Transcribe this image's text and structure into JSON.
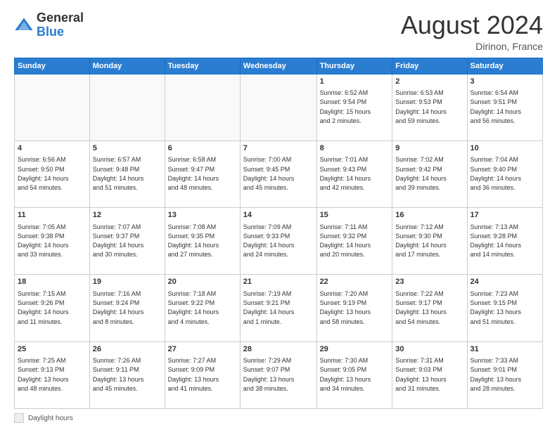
{
  "logo": {
    "line1": "General",
    "line2": "Blue"
  },
  "title": "August 2024",
  "location": "Dirinon, France",
  "days_of_week": [
    "Sunday",
    "Monday",
    "Tuesday",
    "Wednesday",
    "Thursday",
    "Friday",
    "Saturday"
  ],
  "footer": {
    "label": "Daylight hours"
  },
  "weeks": [
    [
      {
        "day": "",
        "info": ""
      },
      {
        "day": "",
        "info": ""
      },
      {
        "day": "",
        "info": ""
      },
      {
        "day": "",
        "info": ""
      },
      {
        "day": "1",
        "info": "Sunrise: 6:52 AM\nSunset: 9:54 PM\nDaylight: 15 hours\nand 2 minutes."
      },
      {
        "day": "2",
        "info": "Sunrise: 6:53 AM\nSunset: 9:53 PM\nDaylight: 14 hours\nand 59 minutes."
      },
      {
        "day": "3",
        "info": "Sunrise: 6:54 AM\nSunset: 9:51 PM\nDaylight: 14 hours\nand 56 minutes."
      }
    ],
    [
      {
        "day": "4",
        "info": "Sunrise: 6:56 AM\nSunset: 9:50 PM\nDaylight: 14 hours\nand 54 minutes."
      },
      {
        "day": "5",
        "info": "Sunrise: 6:57 AM\nSunset: 9:48 PM\nDaylight: 14 hours\nand 51 minutes."
      },
      {
        "day": "6",
        "info": "Sunrise: 6:58 AM\nSunset: 9:47 PM\nDaylight: 14 hours\nand 48 minutes."
      },
      {
        "day": "7",
        "info": "Sunrise: 7:00 AM\nSunset: 9:45 PM\nDaylight: 14 hours\nand 45 minutes."
      },
      {
        "day": "8",
        "info": "Sunrise: 7:01 AM\nSunset: 9:43 PM\nDaylight: 14 hours\nand 42 minutes."
      },
      {
        "day": "9",
        "info": "Sunrise: 7:02 AM\nSunset: 9:42 PM\nDaylight: 14 hours\nand 39 minutes."
      },
      {
        "day": "10",
        "info": "Sunrise: 7:04 AM\nSunset: 9:40 PM\nDaylight: 14 hours\nand 36 minutes."
      }
    ],
    [
      {
        "day": "11",
        "info": "Sunrise: 7:05 AM\nSunset: 9:38 PM\nDaylight: 14 hours\nand 33 minutes."
      },
      {
        "day": "12",
        "info": "Sunrise: 7:07 AM\nSunset: 9:37 PM\nDaylight: 14 hours\nand 30 minutes."
      },
      {
        "day": "13",
        "info": "Sunrise: 7:08 AM\nSunset: 9:35 PM\nDaylight: 14 hours\nand 27 minutes."
      },
      {
        "day": "14",
        "info": "Sunrise: 7:09 AM\nSunset: 9:33 PM\nDaylight: 14 hours\nand 24 minutes."
      },
      {
        "day": "15",
        "info": "Sunrise: 7:11 AM\nSunset: 9:32 PM\nDaylight: 14 hours\nand 20 minutes."
      },
      {
        "day": "16",
        "info": "Sunrise: 7:12 AM\nSunset: 9:30 PM\nDaylight: 14 hours\nand 17 minutes."
      },
      {
        "day": "17",
        "info": "Sunrise: 7:13 AM\nSunset: 9:28 PM\nDaylight: 14 hours\nand 14 minutes."
      }
    ],
    [
      {
        "day": "18",
        "info": "Sunrise: 7:15 AM\nSunset: 9:26 PM\nDaylight: 14 hours\nand 11 minutes."
      },
      {
        "day": "19",
        "info": "Sunrise: 7:16 AM\nSunset: 9:24 PM\nDaylight: 14 hours\nand 8 minutes."
      },
      {
        "day": "20",
        "info": "Sunrise: 7:18 AM\nSunset: 9:22 PM\nDaylight: 14 hours\nand 4 minutes."
      },
      {
        "day": "21",
        "info": "Sunrise: 7:19 AM\nSunset: 9:21 PM\nDaylight: 14 hours\nand 1 minute."
      },
      {
        "day": "22",
        "info": "Sunrise: 7:20 AM\nSunset: 9:19 PM\nDaylight: 13 hours\nand 58 minutes."
      },
      {
        "day": "23",
        "info": "Sunrise: 7:22 AM\nSunset: 9:17 PM\nDaylight: 13 hours\nand 54 minutes."
      },
      {
        "day": "24",
        "info": "Sunrise: 7:23 AM\nSunset: 9:15 PM\nDaylight: 13 hours\nand 51 minutes."
      }
    ],
    [
      {
        "day": "25",
        "info": "Sunrise: 7:25 AM\nSunset: 9:13 PM\nDaylight: 13 hours\nand 48 minutes."
      },
      {
        "day": "26",
        "info": "Sunrise: 7:26 AM\nSunset: 9:11 PM\nDaylight: 13 hours\nand 45 minutes."
      },
      {
        "day": "27",
        "info": "Sunrise: 7:27 AM\nSunset: 9:09 PM\nDaylight: 13 hours\nand 41 minutes."
      },
      {
        "day": "28",
        "info": "Sunrise: 7:29 AM\nSunset: 9:07 PM\nDaylight: 13 hours\nand 38 minutes."
      },
      {
        "day": "29",
        "info": "Sunrise: 7:30 AM\nSunset: 9:05 PM\nDaylight: 13 hours\nand 34 minutes."
      },
      {
        "day": "30",
        "info": "Sunrise: 7:31 AM\nSunset: 9:03 PM\nDaylight: 13 hours\nand 31 minutes."
      },
      {
        "day": "31",
        "info": "Sunrise: 7:33 AM\nSunset: 9:01 PM\nDaylight: 13 hours\nand 28 minutes."
      }
    ]
  ]
}
